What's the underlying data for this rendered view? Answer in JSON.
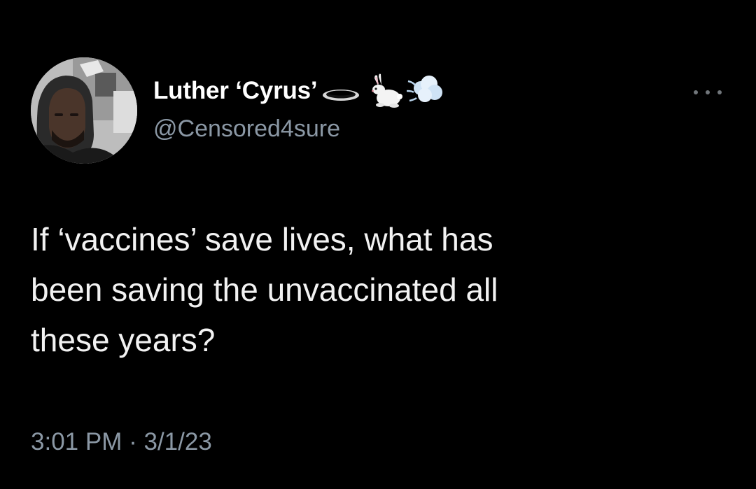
{
  "tweet": {
    "author": {
      "display_name": "Luther ‘Cyrus’",
      "handle": "@Censored4sure",
      "name_emojis": [
        "hole-emoji",
        "rabbit-emoji",
        "dash-emoji"
      ]
    },
    "text": "If ‘vaccines’ save lives, what has\nbeen saving the unvaccinated all\nthese years?",
    "time": "3:01 PM",
    "separator": "·",
    "date": "3/1/23",
    "more_icon": "more-horizontal-icon"
  },
  "colors": {
    "background": "#000000",
    "display_name": "#ffffff",
    "body_text": "#f2f2f2",
    "secondary_text": "#8b98a5",
    "more_icon": "#71767b"
  }
}
